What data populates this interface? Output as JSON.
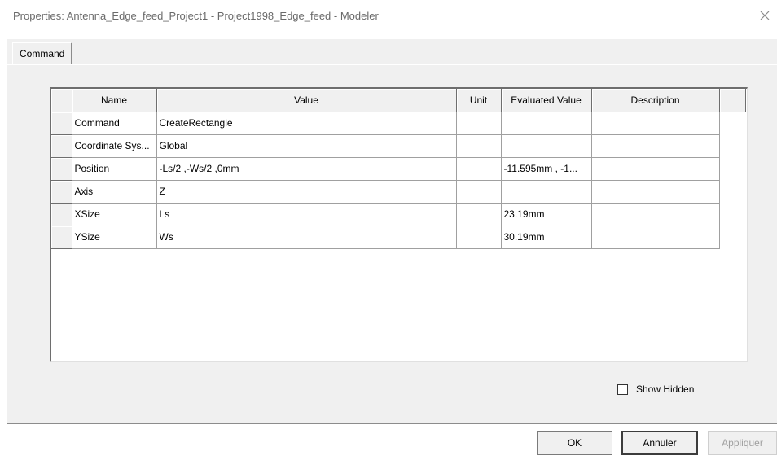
{
  "window": {
    "title": "Properties: Antenna_Edge_feed_Project1 - Project1998_Edge_feed - Modeler",
    "close_icon": "close-icon"
  },
  "tabs": [
    {
      "label": "Command"
    }
  ],
  "grid": {
    "columns": [
      "Name",
      "Value",
      "Unit",
      "Evaluated Value",
      "Description"
    ],
    "rows": [
      {
        "name": "Command",
        "value": "CreateRectangle",
        "unit": "",
        "evaluated": "",
        "description": ""
      },
      {
        "name": "Coordinate Sys...",
        "value": "Global",
        "unit": "",
        "evaluated": "",
        "description": ""
      },
      {
        "name": "Position",
        "value": "-Ls/2 ,-Ws/2 ,0mm",
        "unit": "",
        "evaluated": "-11.595mm , -1...",
        "description": ""
      },
      {
        "name": "Axis",
        "value": "Z",
        "unit": "",
        "evaluated": "",
        "description": ""
      },
      {
        "name": "XSize",
        "value": "Ls",
        "unit": "",
        "evaluated": "23.19mm",
        "description": ""
      },
      {
        "name": "YSize",
        "value": "Ws",
        "unit": "",
        "evaluated": "30.19mm",
        "description": ""
      }
    ]
  },
  "options": {
    "show_hidden_label": "Show Hidden",
    "show_hidden_checked": false
  },
  "buttons": {
    "ok": "OK",
    "cancel": "Annuler",
    "apply": "Appliquer"
  }
}
